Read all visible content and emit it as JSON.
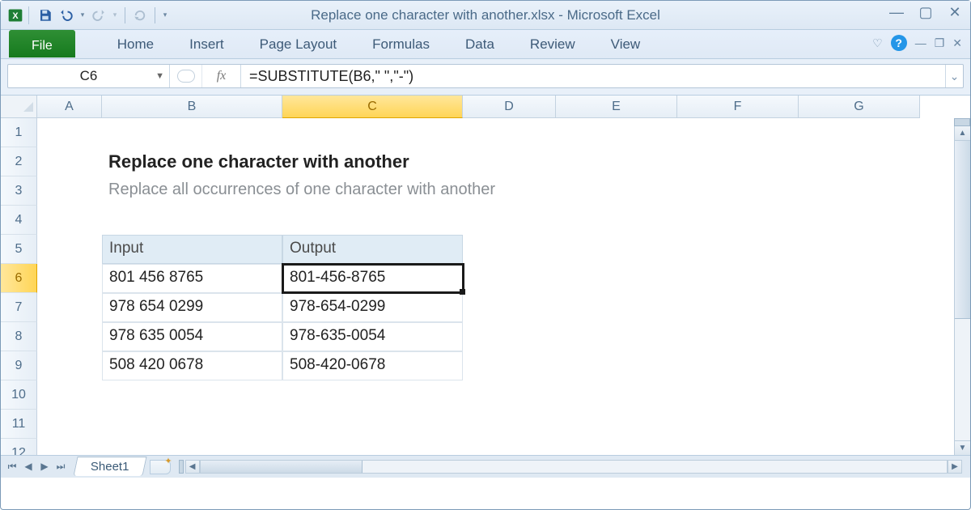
{
  "app": {
    "title": "Replace one character with another.xlsx  -  Microsoft Excel"
  },
  "ribbon": {
    "file": "File",
    "tabs": [
      "Home",
      "Insert",
      "Page Layout",
      "Formulas",
      "Data",
      "Review",
      "View"
    ]
  },
  "formula_bar": {
    "name_box": "C6",
    "fx": "fx",
    "formula": "=SUBSTITUTE(B6,\" \",\"-\")"
  },
  "columns": [
    "A",
    "B",
    "C",
    "D",
    "E",
    "F",
    "G"
  ],
  "rows": [
    "1",
    "2",
    "3",
    "4",
    "5",
    "6",
    "7",
    "8",
    "9",
    "10",
    "11",
    "12"
  ],
  "active": {
    "col": "C",
    "row": "6"
  },
  "content": {
    "title": "Replace one character with another",
    "subtitle": "Replace all occurrences of one character with another",
    "headers": {
      "b": "Input",
      "c": "Output"
    },
    "data": [
      {
        "input": "801 456 8765",
        "output": "801-456-8765"
      },
      {
        "input": "978 654 0299",
        "output": "978-654-0299"
      },
      {
        "input": "978 635 0054",
        "output": "978-635-0054"
      },
      {
        "input": "508 420 0678",
        "output": "508-420-0678"
      }
    ]
  },
  "sheet": {
    "name": "Sheet1"
  }
}
